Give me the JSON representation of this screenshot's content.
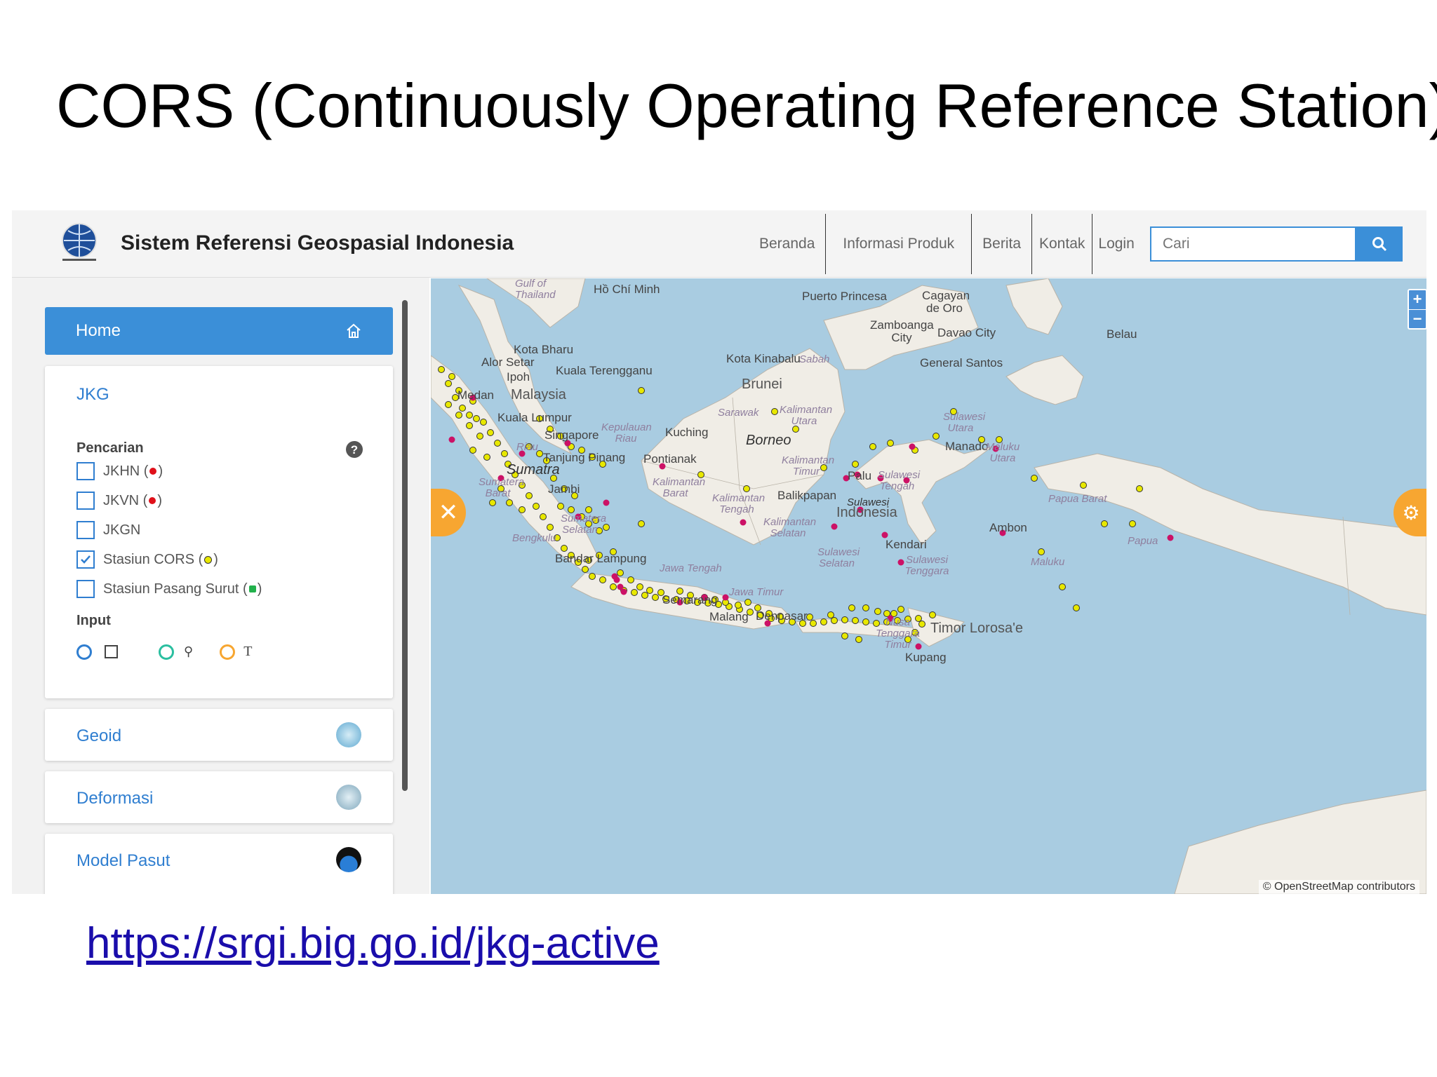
{
  "slide": {
    "title": "CORS (Continuously Operating Reference Station)",
    "url": "https://srgi.big.go.id/jkg-active"
  },
  "header": {
    "site_title": "Sistem Referensi Geospasial Indonesia",
    "nav": [
      "Beranda",
      "Informasi Produk",
      "Berita",
      "Kontak",
      "Login"
    ],
    "search_placeholder": "Cari"
  },
  "sidebar": {
    "home_label": "Home",
    "jkg_title": "JKG",
    "search_label": "Pencarian",
    "layers": [
      {
        "label": "JKHN (",
        "suffix": ")",
        "checked": false,
        "dot_color": "#e0101a"
      },
      {
        "label": "JKVN (",
        "suffix": ")",
        "checked": false,
        "dot_color": "#e0101a"
      },
      {
        "label": "JKGN",
        "suffix": "",
        "checked": false,
        "dot_color": ""
      },
      {
        "label": "Stasiun CORS (",
        "suffix": ")",
        "checked": true,
        "dot_color": "#c9d400"
      },
      {
        "label": "Stasiun Pasang Surut (",
        "suffix": ")",
        "checked": false,
        "dot_color": "#22b14c"
      }
    ],
    "input_label": "Input",
    "panels": [
      "Geoid",
      "Deformasi",
      "Model Pasut"
    ]
  },
  "map": {
    "labels": {
      "gulf": "Gulf of Thailand",
      "hcm": "Hồ Chí Minh",
      "puerto": "Puerto Princesa",
      "cagayan": "Cagayan de Oro",
      "zamboanga": "Zamboanga City",
      "davao": "Davao City",
      "belau": "Belau",
      "kota_bharu": "Kota Bharu",
      "alor_setar": "Alor Setar",
      "kuala_terengganu": "Kuala Terengganu",
      "ipoh": "Ipoh",
      "malaysia": "Malaysia",
      "medan": "Medan",
      "kuala_lumpur": "Kuala Lumpur",
      "kota_kinabalu": "Kota Kinabalu",
      "sabah": "Sabah",
      "general_santos": "General Santos",
      "brunei": "Brunei",
      "sarawak": "Sarawak",
      "kaltara": "Kalimantan Utara",
      "sulut": "Sulawesi Utara",
      "singapore": "Singapore",
      "kepri": "Kepulauan Riau",
      "riau": "Riau",
      "kuching": "Kuching",
      "borneo": "Borneo",
      "manado": "Manado",
      "maluku_utara": "Maluku Utara",
      "tanjung_pinang": "Tanjung Pinang",
      "pontianak": "Pontianak",
      "sumatra": "Sumatra",
      "kaltim": "Kalimantan Timur",
      "sumbar": "Sumatera Barat",
      "jambi": "Jambi",
      "kalbar": "Kalimantan Barat",
      "palu": "Palu",
      "sulteng": "Sulawesi Tengah",
      "balikpapan": "Balikpapan",
      "kalteng": "Kalimantan Tengah",
      "papua_barat": "Papua Barat",
      "indonesia": "Indonesia",
      "sulawesi": "Sulawesi",
      "sumsel": "Sumatera Selatan",
      "kalsel": "Kalimantan Selatan",
      "ambon": "Ambon",
      "bengkulu": "Bengkulu",
      "kendari": "Kendari",
      "papua": "Papua",
      "sulsel": "Sulawesi Selatan",
      "maluku": "Maluku",
      "bandar_lampung": "Bandar Lampung",
      "sultra": "Sulawesi Tenggara",
      "jateng": "Jawa Tengah",
      "jatim": "Jawa Timur",
      "semarang": "Semarang",
      "malang": "Malang",
      "denpasar": "Denpasar",
      "ntt": "Nusa Tenggara Timur",
      "timor": "Timor Lorosa'e",
      "kupang": "Kupang"
    },
    "zoom_in": "+",
    "zoom_out": "−",
    "attribution": "© OpenStreetMap contributors",
    "colors": {
      "sea": "#a9cce1",
      "land": "#f0ede6",
      "cors": "#e8e800",
      "jkhn": "#cc1166"
    }
  }
}
